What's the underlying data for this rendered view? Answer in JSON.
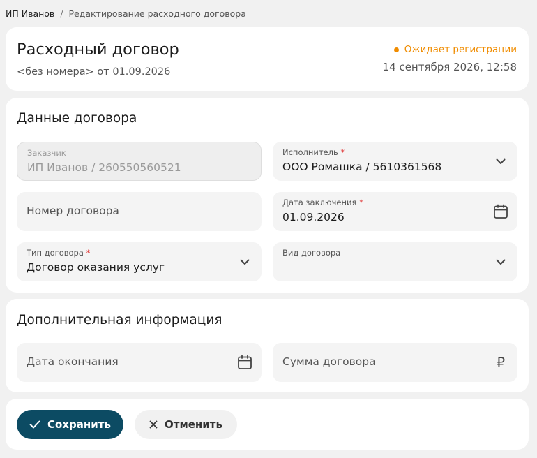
{
  "breadcrumb": {
    "root": "ИП Иванов",
    "separator": "/",
    "current": "Редактирование расходного договора"
  },
  "header": {
    "title": "Расходный договор",
    "subtitle": "<без номера> от 01.09.2026",
    "status": "Ожидает регистрации",
    "status_color": "#f08c00",
    "datetime": "14 сентября 2026, 12:58"
  },
  "contract": {
    "section_title": "Данные договора",
    "customer": {
      "label": "Заказчик",
      "value": "ИП Иванов / 260550560521"
    },
    "executor": {
      "label": "Исполнитель",
      "required": "*",
      "value": "ООО Ромашка / 5610361568",
      "icon": "chevron-down-icon"
    },
    "number": {
      "placeholder": "Номер договора"
    },
    "date": {
      "label": "Дата заключения",
      "required": "*",
      "value": "01.09.2026",
      "icon": "calendar-icon"
    },
    "type": {
      "label": "Тип договора",
      "required": "*",
      "value": "Договор оказания услуг",
      "icon": "chevron-down-icon"
    },
    "kind": {
      "label": "Вид договора",
      "value": "",
      "icon": "chevron-down-icon"
    }
  },
  "extra": {
    "section_title": "Дополнительная информация",
    "end_date": {
      "placeholder": "Дата окончания",
      "icon": "calendar-icon"
    },
    "amount": {
      "placeholder": "Сумма договора",
      "icon": "ruble-icon",
      "currency_symbol": "₽"
    }
  },
  "actions": {
    "save_label": "Сохранить",
    "cancel_label": "Отменить",
    "accent": "#0c4b63"
  }
}
